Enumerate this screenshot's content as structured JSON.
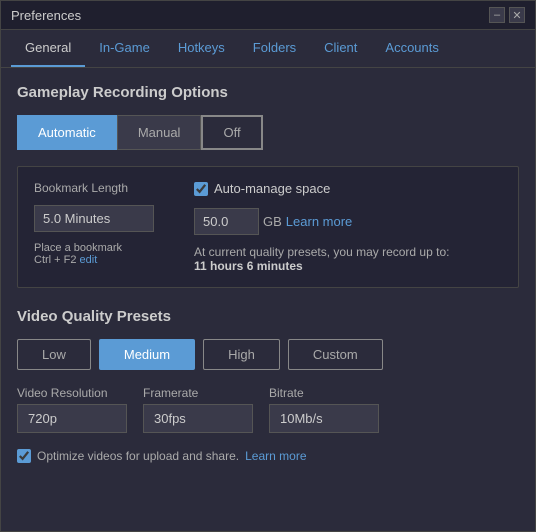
{
  "window": {
    "title": "Preferences",
    "minimize_label": "–",
    "close_label": "✕"
  },
  "tabs": {
    "items": [
      {
        "id": "general",
        "label": "General",
        "active": true
      },
      {
        "id": "in-game",
        "label": "In-Game",
        "active": false
      },
      {
        "id": "hotkeys",
        "label": "Hotkeys",
        "active": false
      },
      {
        "id": "folders",
        "label": "Folders",
        "active": false
      },
      {
        "id": "client",
        "label": "Client",
        "active": false
      },
      {
        "id": "accounts",
        "label": "Accounts",
        "active": false
      }
    ]
  },
  "gameplay": {
    "section_title": "Gameplay Recording Options",
    "mode_automatic": "Automatic",
    "mode_manual": "Manual",
    "mode_off": "Off",
    "bookmark_label": "Bookmark Length",
    "bookmark_value": "5.0 Minutes",
    "bookmark_hint": "Place a bookmark",
    "bookmark_shortcut": "Ctrl + F2",
    "bookmark_edit": "edit",
    "auto_manage_label": "Auto-manage space",
    "gb_value": "50.0",
    "gb_unit": "GB",
    "learn_more": "Learn more",
    "record_info_line1": "At current quality presets, you may record up to:",
    "record_info_line2": "11 hours  6 minutes"
  },
  "video_quality": {
    "section_title": "Video Quality Presets",
    "btn_low": "Low",
    "btn_medium": "Medium",
    "btn_high": "High",
    "btn_custom": "Custom",
    "resolution_label": "Video Resolution",
    "resolution_value": "720p",
    "framerate_label": "Framerate",
    "framerate_value": "30fps",
    "bitrate_label": "Bitrate",
    "bitrate_value": "10Mb/s",
    "optimize_text": "Optimize videos for upload and share.",
    "optimize_learn_more": "Learn more"
  }
}
